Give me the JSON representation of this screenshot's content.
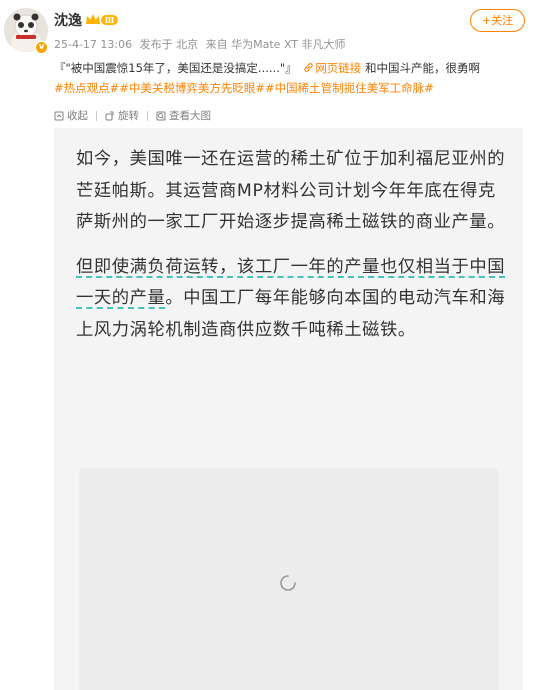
{
  "post": {
    "username": "沈逸",
    "vip_level": "Ⅲ",
    "follow_label": "+关注",
    "meta": {
      "date": "25-4-17 13:06",
      "location": "发布于 北京",
      "source": "来自 华为Mate XT 非凡大师"
    },
    "text": {
      "quote": "『\"被中国震惊15年了，美国还是没搞定......\"』",
      "link_label": "网页链接",
      "after_link": "和中国斗产能，很勇啊",
      "hashtags": "#热点观点##中美关税博弈美方先眨眼##中国稀土管制扼住美军工命脉#"
    },
    "toolbar": {
      "collect": "收起",
      "rotate": "旋转",
      "view_large": "查看大图"
    },
    "article": {
      "para1": "如今，美国唯一还在运营的稀土矿位于加利福尼亚州的芒廷帕斯。其运营商MP材料公司计划今年年底在得克萨斯州的一家工厂开始逐步提高稀土磁铁的商业产量。",
      "para2_underlined": "但即使满负荷运转，该工厂一年的产量也仅相当于中国一天的产量",
      "para2_rest": "。中国工厂每年能够向本国的电动汽车和海上风力涡轮机制造商供应数千吨稀土磁铁。"
    },
    "colors": {
      "accent": "#ff8200",
      "underline": "#2dbab0",
      "meta_gray": "#939393"
    }
  }
}
